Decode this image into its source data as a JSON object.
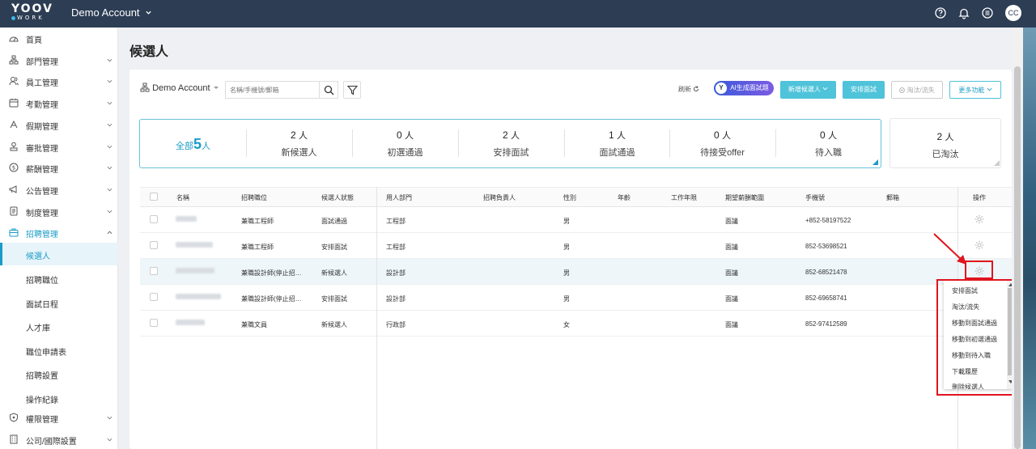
{
  "topbar": {
    "logo_top": "YOOV",
    "logo_bottom": "WORK",
    "account": "Demo Account",
    "avatar": "CC",
    "icons": [
      "help-icon",
      "bell-icon",
      "settings-circle-icon"
    ]
  },
  "sidebar": {
    "items": [
      {
        "label": "首頁",
        "icon": "home-icon"
      },
      {
        "label": "部門管理",
        "icon": "org-icon"
      },
      {
        "label": "員工管理",
        "icon": "users-icon"
      },
      {
        "label": "考勤管理",
        "icon": "calendar-icon"
      },
      {
        "label": "假期管理",
        "icon": "leave-icon"
      },
      {
        "label": "審批管理",
        "icon": "approval-icon"
      },
      {
        "label": "薪酬管理",
        "icon": "salary-icon"
      },
      {
        "label": "公告管理",
        "icon": "megaphone-icon"
      },
      {
        "label": "制度管理",
        "icon": "document-icon"
      },
      {
        "label": "招聘管理",
        "icon": "briefcase-icon"
      }
    ],
    "subitems": [
      "候選人",
      "招聘職位",
      "面試日程",
      "人才庫",
      "職位申請表",
      "招聘設置",
      "操作紀錄"
    ],
    "bottom_items": [
      {
        "label": "權限管理",
        "icon": "shield-icon"
      },
      {
        "label": "公司/國際設置",
        "icon": "building-icon"
      }
    ]
  },
  "page": {
    "title": "候選人"
  },
  "toolbar": {
    "account": "Demo Account",
    "search_placeholder": "名稱/手機號/郵箱",
    "refresh": "刷新",
    "ai": "AI生成面試題",
    "add": "新增候選人",
    "schedule": "安排面試",
    "reject": "淘汰/流失",
    "more": "更多功能"
  },
  "stats": {
    "all_prefix": "全部",
    "all_count": "5",
    "all_unit": "人",
    "items": [
      {
        "count": "2",
        "unit": "人",
        "label": "新候選人"
      },
      {
        "count": "0",
        "unit": "人",
        "label": "初選通過"
      },
      {
        "count": "2",
        "unit": "人",
        "label": "安排面試"
      },
      {
        "count": "1",
        "unit": "人",
        "label": "面試通過"
      },
      {
        "count": "0",
        "unit": "人",
        "label": "待接受offer"
      },
      {
        "count": "0",
        "unit": "人",
        "label": "待入職"
      }
    ],
    "eliminated": {
      "count": "2",
      "unit": "人",
      "label": "已淘汰"
    }
  },
  "table": {
    "headers": [
      "名稱",
      "招聘職位",
      "候選人狀態",
      "用人部門",
      "招聘負責人",
      "性別",
      "年齡",
      "工作年限",
      "期望薪酬範圍",
      "手機號",
      "郵箱",
      "操作"
    ],
    "rows": [
      {
        "position": "兼職工程師",
        "status": "面試通過",
        "dept": "工程部",
        "gender": "男",
        "salary": "面議",
        "phone": "+852-58197522"
      },
      {
        "position": "兼職工程師",
        "status": "安排面試",
        "dept": "工程部",
        "gender": "男",
        "salary": "面議",
        "phone": "852-53698521"
      },
      {
        "position": "兼職設計師(停止招…",
        "status": "新候選人",
        "dept": "設計部",
        "gender": "男",
        "salary": "面議",
        "phone": "852-68521478"
      },
      {
        "position": "兼職設計師(停止招…",
        "status": "安排面試",
        "dept": "設計部",
        "gender": "男",
        "salary": "面議",
        "phone": "852-69658741"
      },
      {
        "position": "兼職文員",
        "status": "新候選人",
        "dept": "行政部",
        "gender": "女",
        "salary": "面議",
        "phone": "852-97412589"
      }
    ]
  },
  "menu": {
    "items": [
      "安排面試",
      "淘汰/流失",
      "移動到面試通過",
      "移動到初選通過",
      "移動到待入職",
      "下載履歷",
      "刪除候選人"
    ]
  },
  "colors": {
    "topbar": "#2c3d54",
    "accent": "#1a9bc7",
    "teal": "#4fc3d9",
    "annotation": "#e0141e"
  }
}
